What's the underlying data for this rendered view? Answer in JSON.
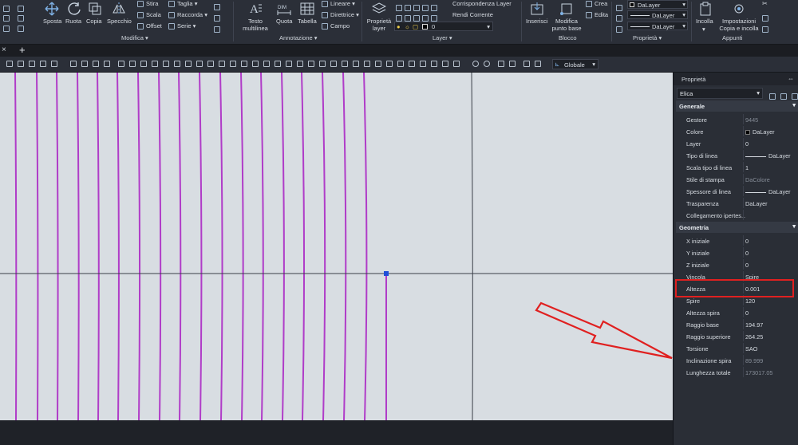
{
  "ribbon": {
    "modifica": {
      "title": "Modifica",
      "big": [
        {
          "label": "Sposta",
          "icon": "move-icon"
        },
        {
          "label": "Ruota",
          "icon": "rotate-icon"
        },
        {
          "label": "Copia",
          "icon": "copy-icon"
        },
        {
          "label": "Specchio",
          "icon": "mirror-icon"
        }
      ],
      "small": [
        {
          "label": "Stira",
          "icon": "stretch-icon"
        },
        {
          "label": "Scala",
          "icon": "scale-icon"
        },
        {
          "label": "Offset",
          "icon": "offset-icon"
        },
        {
          "label": "Taglia",
          "icon": "trim-icon"
        },
        {
          "label": "Raccorda",
          "icon": "fillet-icon"
        },
        {
          "label": "Serie",
          "icon": "array-icon"
        }
      ]
    },
    "annotazione": {
      "title": "Annotazione",
      "big": [
        {
          "label": "Testo multilinea",
          "icon": "mtext-icon"
        },
        {
          "label": "Quota",
          "icon": "dimension-icon"
        },
        {
          "label": "Tabella",
          "icon": "table-icon"
        }
      ],
      "small": [
        {
          "label": "Lineare",
          "icon": "linear-dim-icon"
        },
        {
          "label": "Direttrice",
          "icon": "leader-icon"
        },
        {
          "label": "Campo",
          "icon": "field-icon"
        }
      ]
    },
    "layer": {
      "title": "Layer",
      "big_label": "Proprietà layer",
      "small": [
        {
          "label": "Corrispondenza Layer"
        },
        {
          "label": "Rendi Corrente"
        }
      ],
      "current_layer": "0"
    },
    "blocco": {
      "title": "Blocco",
      "big": [
        {
          "label": "Inserisci",
          "icon": "insert-icon"
        },
        {
          "label": "Modifica punto base",
          "icon": "base-point-icon"
        }
      ],
      "small": [
        {
          "label": "Crea"
        },
        {
          "label": "Edita"
        }
      ]
    },
    "proprieta": {
      "title": "Proprietà",
      "dropdowns": [
        "DaLayer",
        "DaLayer",
        "DaLayer"
      ]
    },
    "appunti": {
      "title": "Appunti",
      "big": [
        {
          "label": "Incolla",
          "icon": "paste-icon"
        },
        {
          "label": "Impostazioni Copia e incolla",
          "icon": "paste-settings-icon"
        }
      ]
    }
  },
  "doctabs": {
    "add_label": "+",
    "close_label": "×"
  },
  "toolbar": {
    "ucs_label": "Globale"
  },
  "properties_panel": {
    "title": "Proprietà",
    "selected_object": "Elica",
    "sections": [
      {
        "name": "Generale",
        "rows": [
          {
            "key": "Gestore",
            "value": "9445",
            "dim": true
          },
          {
            "key": "Colore",
            "value": "DaLayer",
            "swatch": "#000000"
          },
          {
            "key": "Layer",
            "value": "0"
          },
          {
            "key": "Tipo di linea",
            "value": "DaLayer",
            "line": true
          },
          {
            "key": "Scala tipo di linea",
            "value": "1"
          },
          {
            "key": "Stile di stampa",
            "value": "DaColore",
            "dim": true
          },
          {
            "key": "Spessore di linea",
            "value": "DaLayer",
            "line": true
          },
          {
            "key": "Trasparenza",
            "value": "DaLayer"
          },
          {
            "key": "Collegamento ipertes...",
            "value": ""
          }
        ]
      },
      {
        "name": "Geometria",
        "rows": [
          {
            "key": "X iniziale",
            "value": "0"
          },
          {
            "key": "Y iniziale",
            "value": "0"
          },
          {
            "key": "Z iniziale",
            "value": "0"
          },
          {
            "key": "Vincola",
            "value": "Spire"
          },
          {
            "key": "Altezza",
            "value": "0.001",
            "highlight": true
          },
          {
            "key": "Spire",
            "value": "120"
          },
          {
            "key": "Altezza spira",
            "value": "0"
          },
          {
            "key": "Raggio base",
            "value": "194.97"
          },
          {
            "key": "Raggio superiore",
            "value": "264.25"
          },
          {
            "key": "Torsione",
            "value": "SAO"
          },
          {
            "key": "Inclinazione spira",
            "value": "89.999",
            "dim": true
          },
          {
            "key": "Lunghezza totale",
            "value": "173017.05",
            "dim": true
          }
        ]
      }
    ]
  },
  "colors": {
    "helix": "#b03cc8",
    "grip": "#1f4fd8",
    "annotation_red": "#e02020",
    "canvas_bg": "#d8dde2"
  }
}
